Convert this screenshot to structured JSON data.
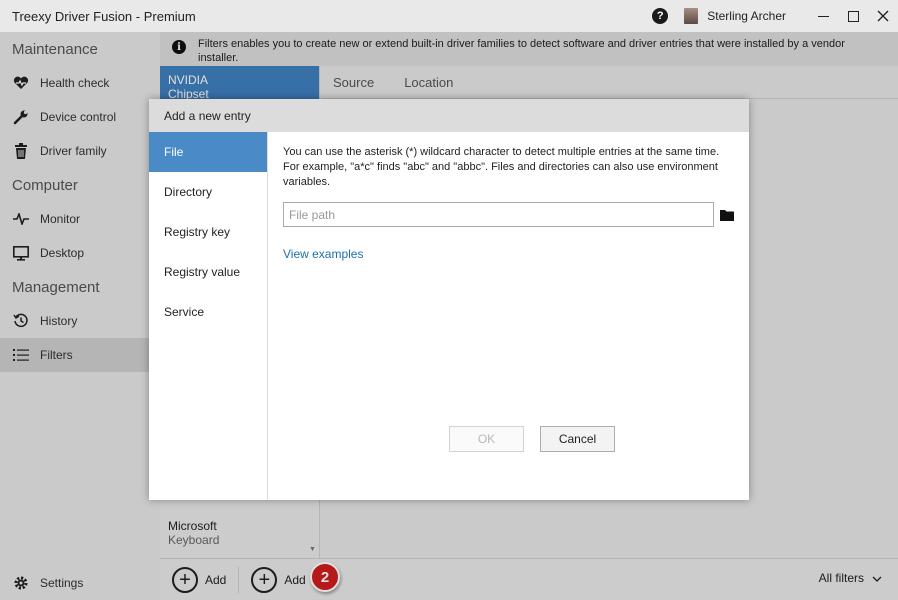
{
  "window": {
    "title": "Treexy Driver Fusion - Premium",
    "user_name": "Sterling Archer"
  },
  "sidebar": {
    "sections": [
      {
        "label": "Maintenance",
        "items": [
          {
            "label": "Health check",
            "icon": "heart-icon"
          },
          {
            "label": "Device control",
            "icon": "wrench-icon"
          },
          {
            "label": "Driver family",
            "icon": "trash-icon"
          }
        ]
      },
      {
        "label": "Computer",
        "items": [
          {
            "label": "Monitor",
            "icon": "pulse-icon"
          },
          {
            "label": "Desktop",
            "icon": "monitor-icon"
          }
        ]
      },
      {
        "label": "Management",
        "items": [
          {
            "label": "History",
            "icon": "history-icon"
          },
          {
            "label": "Filters",
            "icon": "list-icon",
            "active": true
          }
        ]
      }
    ],
    "settings_label": "Settings"
  },
  "banner": {
    "text": "Filters enables you to create new or extend built-in driver families to detect software and driver entries that were installed by a vendor installer."
  },
  "entries": [
    {
      "name": "NVIDIA",
      "sub": "Chipset",
      "selected": true
    },
    {
      "name": "Microsoft",
      "sub": "Keyboard",
      "selected": false
    }
  ],
  "columns": [
    "Source",
    "Location"
  ],
  "bottombar": {
    "add_label_1": "Add",
    "add_label_2": "Add",
    "badge": "2",
    "all_filters": "All filters"
  },
  "dialog": {
    "title": "Add a new entry",
    "tabs": [
      "File",
      "Directory",
      "Registry key",
      "Registry value",
      "Service"
    ],
    "active_tab": "File",
    "description": "You can use the asterisk (*) wildcard character to detect multiple entries at the same time. For example, \"a*c\" finds \"abc\" and \"abbc\". Files and directories can also use environment variables.",
    "path_placeholder": "File path",
    "path_value": "",
    "examples_link": "View examples",
    "ok_label": "OK",
    "cancel_label": "Cancel"
  },
  "colors": {
    "accent": "#4a8ac7",
    "selected_entry": "#3f7fbf",
    "badge": "#d01d1d",
    "link": "#1f6fb0"
  }
}
